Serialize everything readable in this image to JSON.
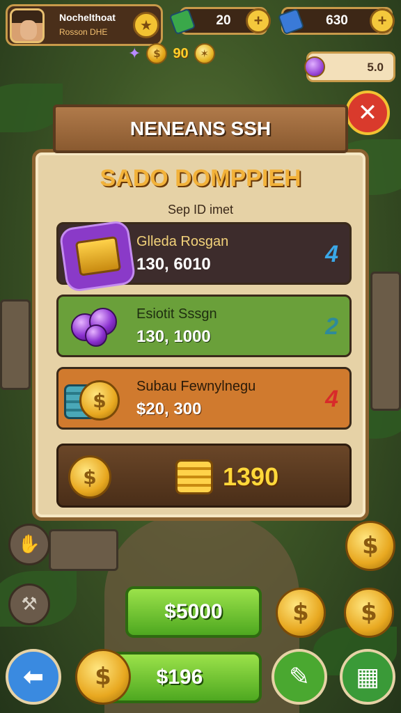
{
  "player": {
    "name": "Nochelthoat",
    "subtitle": "Rosson DHE"
  },
  "resources": {
    "green_gems": "20",
    "blue_gems": "630",
    "tickets": "5.0",
    "coins_mini": "90"
  },
  "icons": {
    "star": "star-icon",
    "plus": "plus-icon",
    "close": "close-icon",
    "back": "back-arrow-icon"
  },
  "panel": {
    "title": "NENEANS SSH",
    "heading": "SADO DOMPPIEH",
    "subheading": "Sep ID imet",
    "rows": [
      {
        "name": "Glleda Rosgan",
        "amount": "130, 6010",
        "badge": "4",
        "color": "#3d2c2c",
        "badge_color": "#3aa8e8"
      },
      {
        "name": "Esiotit Sssgn",
        "amount": "130, 1000",
        "badge": "2",
        "color": "#6aa03a",
        "badge_color": "#2e8a9a"
      },
      {
        "name": "Subau Fewnylnegu",
        "amount": "$20, 300",
        "badge": "4",
        "color": "#d07a2e",
        "badge_color": "#d82a2a"
      }
    ],
    "total": "1390"
  },
  "buttons": {
    "top_green": "$5000",
    "bottom_green": "$196"
  },
  "colors": {
    "accent_gold": "#f2c232",
    "wood": "#8a5a30",
    "parchment": "#e6d2a6"
  }
}
